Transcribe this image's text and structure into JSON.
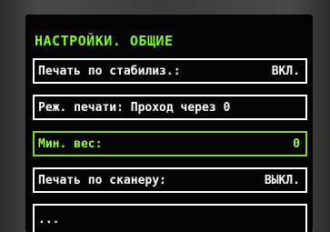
{
  "screen": {
    "title": "НАСТРОЙКИ. ОБЩИЕ",
    "colors": {
      "accent": "#7dff23",
      "text": "#ffffff",
      "background": "#050505"
    },
    "items": [
      {
        "label": "Печать по стабилиз.:",
        "value": "ВКЛ."
      },
      {
        "label": "Реж. печати: Проход через 0",
        "value": ""
      },
      {
        "label": "Мин. вес:",
        "value": "0"
      },
      {
        "label": "Печать по сканеру:",
        "value": "ВЫКЛ."
      },
      {
        "label": "...",
        "value": ""
      }
    ],
    "selected_index": 2
  }
}
